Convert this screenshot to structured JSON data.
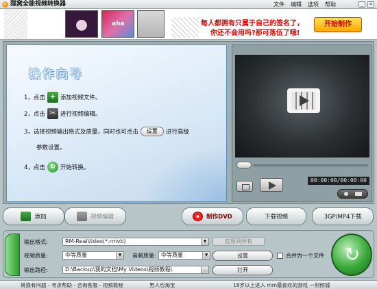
{
  "window": {
    "title": "狸窝全能视频转换器",
    "menu": [
      "文件",
      "编辑",
      "选项",
      "帮助"
    ],
    "controls": [
      "_",
      "×"
    ]
  },
  "banner": {
    "photo2_text": "aha",
    "ad_line1": "每人都拥有只属于自己的签名了，",
    "ad_line2": "你还不会用吗?那可落伍了哦!",
    "start_button": "开始制作"
  },
  "guide": {
    "title": "操作向导",
    "step1_prefix": "1，点击",
    "step1_suffix": "添加视频文件。",
    "step2_prefix": "2，点击",
    "step2_suffix": "进行视频编辑。",
    "step3_prefix": "3，选择视频输出格式及质量，同时也可点击",
    "step3_button": "设置",
    "step3_suffix": "进行高级",
    "step3_line2": "参数设置。",
    "step4_prefix": "4，点击",
    "step4_suffix": "开始转换。"
  },
  "preview": {
    "timecode": "00:00:00/00:00:00"
  },
  "actions": {
    "add": "添加",
    "edit": "视频编辑",
    "dvd": "制作DVD",
    "download": "下载视频",
    "mobile": "3GP/MP4下载"
  },
  "settings": {
    "format_label": "输出格式:",
    "format_value": "RM-RealVideo(*.rmvb)",
    "apply_all": "应用到所有",
    "video_quality_label": "视频质量:",
    "video_quality_value": "中等质量",
    "audio_quality_label": "音频质量:",
    "audio_quality_value": "中等质量",
    "settings_button": "设置",
    "merge_label": "合并为一个文件",
    "path_label": "输出路径:",
    "path_value": "D:\\Backup\\我的文档\\My Videos\\视频教程\\",
    "open_button": "打开"
  },
  "statusbar": {
    "left": "转换有问题 - 寻求帮助 - 咨询客服 - 视频教程",
    "mid": "男人也淘宝",
    "right": "18岁以上进入  mm最喜欢的游戏  一刻倾城"
  },
  "colors": {
    "accent_green": "#2f9c2f",
    "ad_red": "#e00000",
    "start_button_bg": "#ffc21a",
    "guide_bg": "#d8e8f6"
  }
}
